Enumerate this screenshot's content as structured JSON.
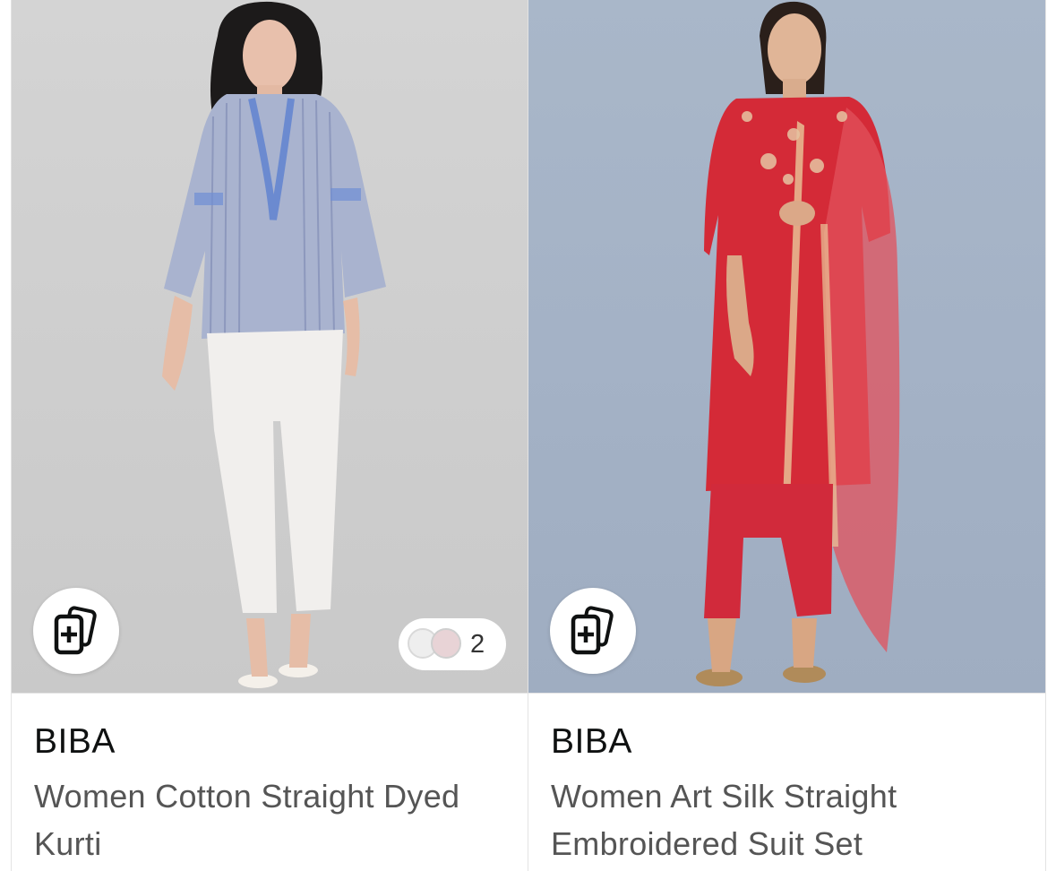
{
  "products": [
    {
      "brand": "BIBA",
      "title": "Women Cotton Straight Dyed Kurti",
      "swatches": {
        "count": "2",
        "colors": [
          "#eeeeee",
          "#e8d3d6"
        ]
      },
      "compare_icon": "add-to-compare-icon"
    },
    {
      "brand": "BIBA",
      "title": "Women Art Silk Straight Embroidered Suit Set",
      "compare_icon": "add-to-compare-icon"
    }
  ]
}
